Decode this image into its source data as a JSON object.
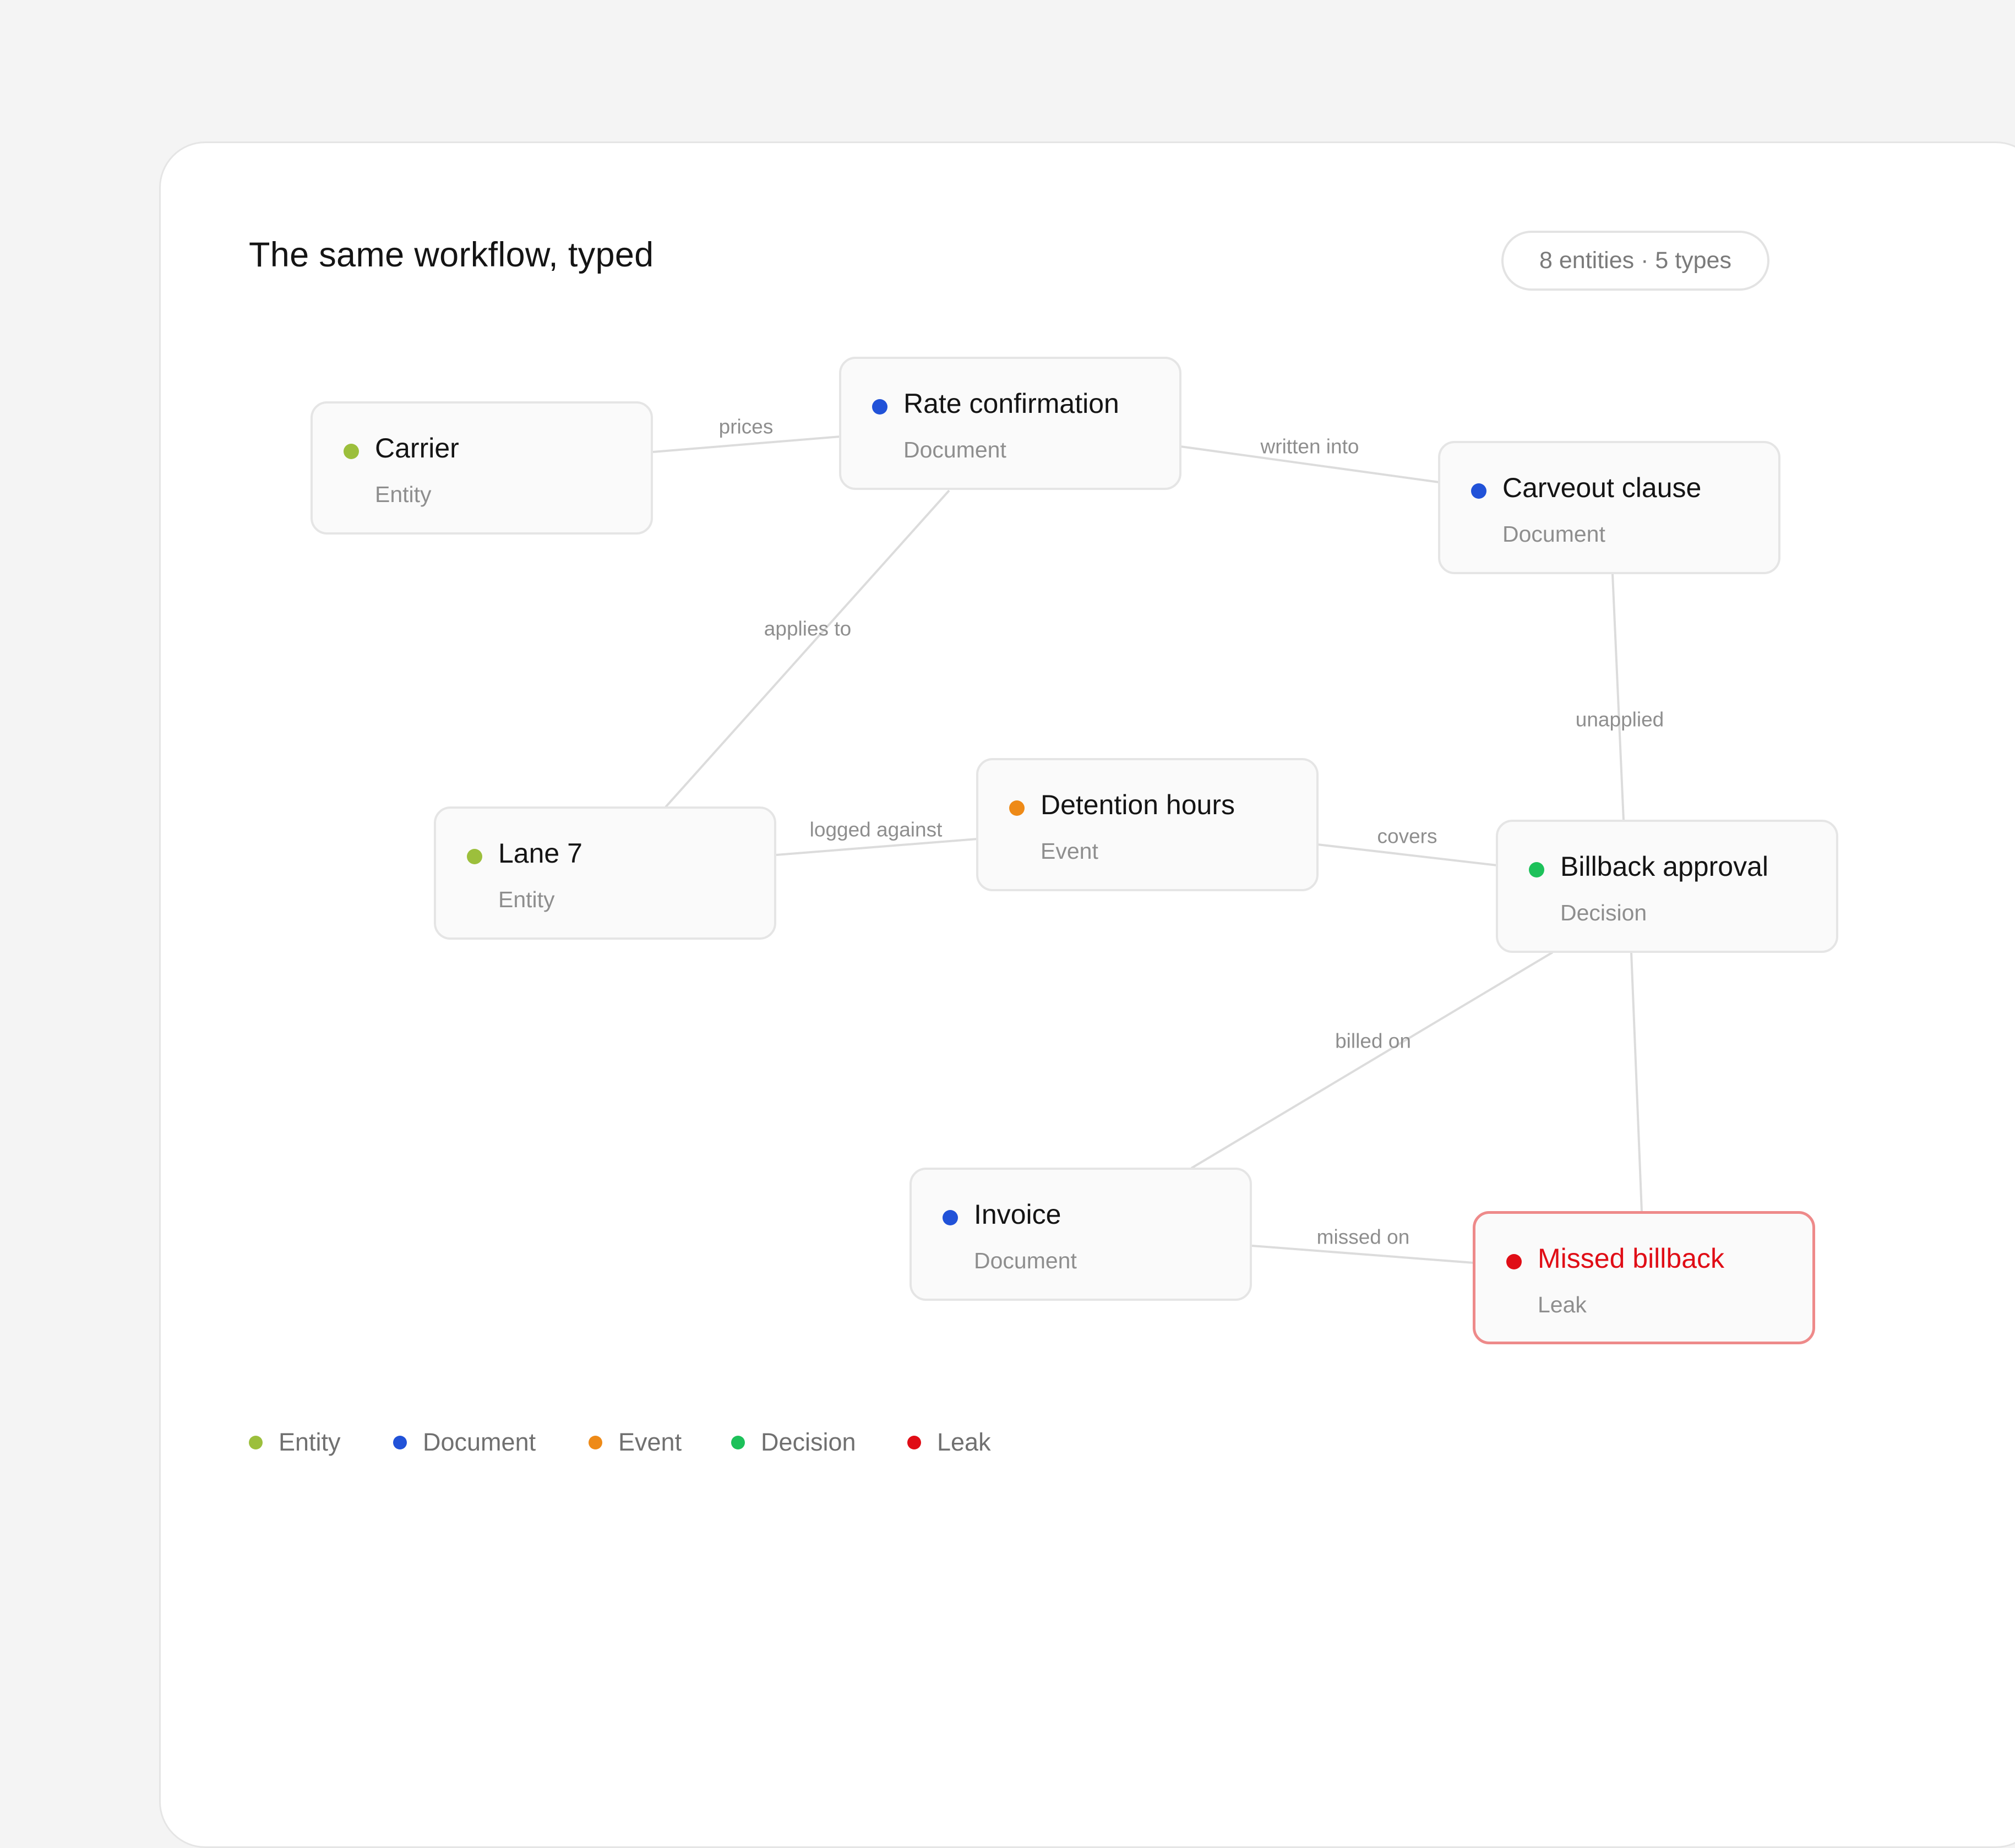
{
  "header": {
    "title": "The same workflow, typed",
    "badge": "8 entities · 5 types"
  },
  "types": {
    "Entity": "#9cbf3c",
    "Document": "#2152d8",
    "Event": "#ee8a17",
    "Decision": "#1dc15a",
    "Leak": "#e00d16"
  },
  "nodes": [
    {
      "id": "carrier",
      "name": "Carrier",
      "type": "Entity"
    },
    {
      "id": "rate-confirmation",
      "name": "Rate confirmation",
      "type": "Document"
    },
    {
      "id": "carveout-clause",
      "name": "Carveout clause",
      "type": "Document"
    },
    {
      "id": "lane-7",
      "name": "Lane 7",
      "type": "Entity"
    },
    {
      "id": "detention-hours",
      "name": "Detention hours",
      "type": "Event"
    },
    {
      "id": "billback-approval",
      "name": "Billback approval",
      "type": "Decision"
    },
    {
      "id": "invoice",
      "name": "Invoice",
      "type": "Document"
    },
    {
      "id": "missed-billback",
      "name": "Missed billback",
      "type": "Leak",
      "highlight": true
    }
  ],
  "edges": [
    {
      "from": "carrier",
      "to": "rate-confirmation",
      "label": "prices"
    },
    {
      "from": "rate-confirmation",
      "to": "carveout-clause",
      "label": "written into"
    },
    {
      "from": "rate-confirmation",
      "to": "lane-7",
      "label": "applies to"
    },
    {
      "from": "carveout-clause",
      "to": "billback-approval",
      "label": "unapplied"
    },
    {
      "from": "lane-7",
      "to": "detention-hours",
      "label": "logged against"
    },
    {
      "from": "detention-hours",
      "to": "billback-approval",
      "label": "covers"
    },
    {
      "from": "billback-approval",
      "to": "invoice",
      "label": "billed on"
    },
    {
      "from": "billback-approval",
      "to": "missed-billback",
      "label": ""
    },
    {
      "from": "invoice",
      "to": "missed-billback",
      "label": "missed on"
    }
  ],
  "legend": [
    {
      "label": "Entity",
      "color": "#9cbf3c"
    },
    {
      "label": "Document",
      "color": "#2152d8"
    },
    {
      "label": "Event",
      "color": "#ee8a17"
    },
    {
      "label": "Decision",
      "color": "#1dc15a"
    },
    {
      "label": "Leak",
      "color": "#e00d16"
    }
  ]
}
